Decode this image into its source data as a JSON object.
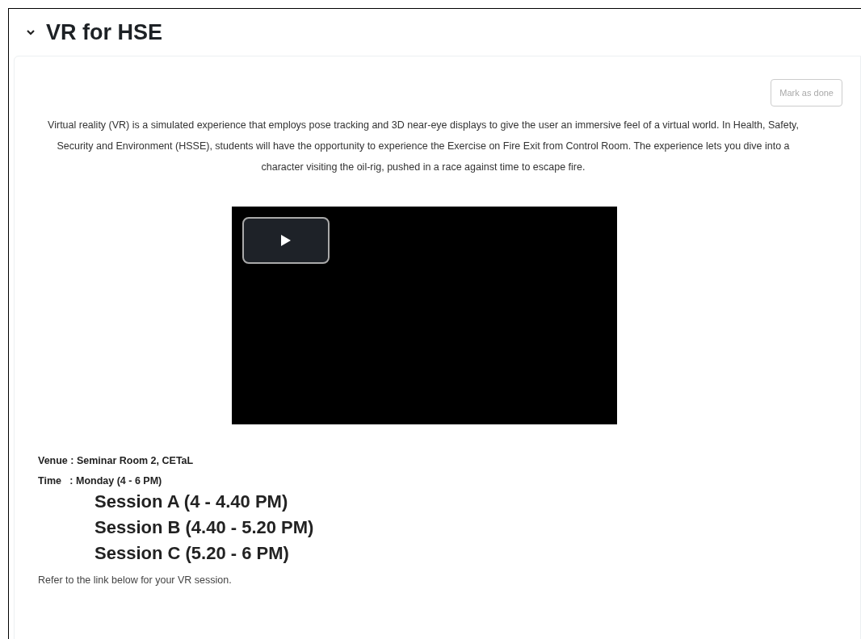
{
  "section": {
    "title": "VR for HSE",
    "expanded": true
  },
  "mark_button": "Mark as done",
  "description": "Virtual reality (VR) is a simulated experience that employs pose tracking and 3D near-eye displays to give the user an immersive feel of a virtual world. In Health, Safety, Security and Environment (HSSE), students will have the opportunity to experience the Exercise on Fire Exit from Control Room. The experience lets you dive into a character visiting the oil-rig, pushed in a race against time to escape fire.",
  "video": {
    "playing": false
  },
  "details": [
    "Venue : Seminar Room 2, CETaL",
    "Time   : Monday (4 - 6 PM)"
  ],
  "sessions": [
    "Session A (4 - 4.40 PM)",
    "Session B (4.40 - 5.20 PM)",
    "Session C (5.20 - 6 PM)"
  ],
  "note": "Refer to the link below for your VR session."
}
